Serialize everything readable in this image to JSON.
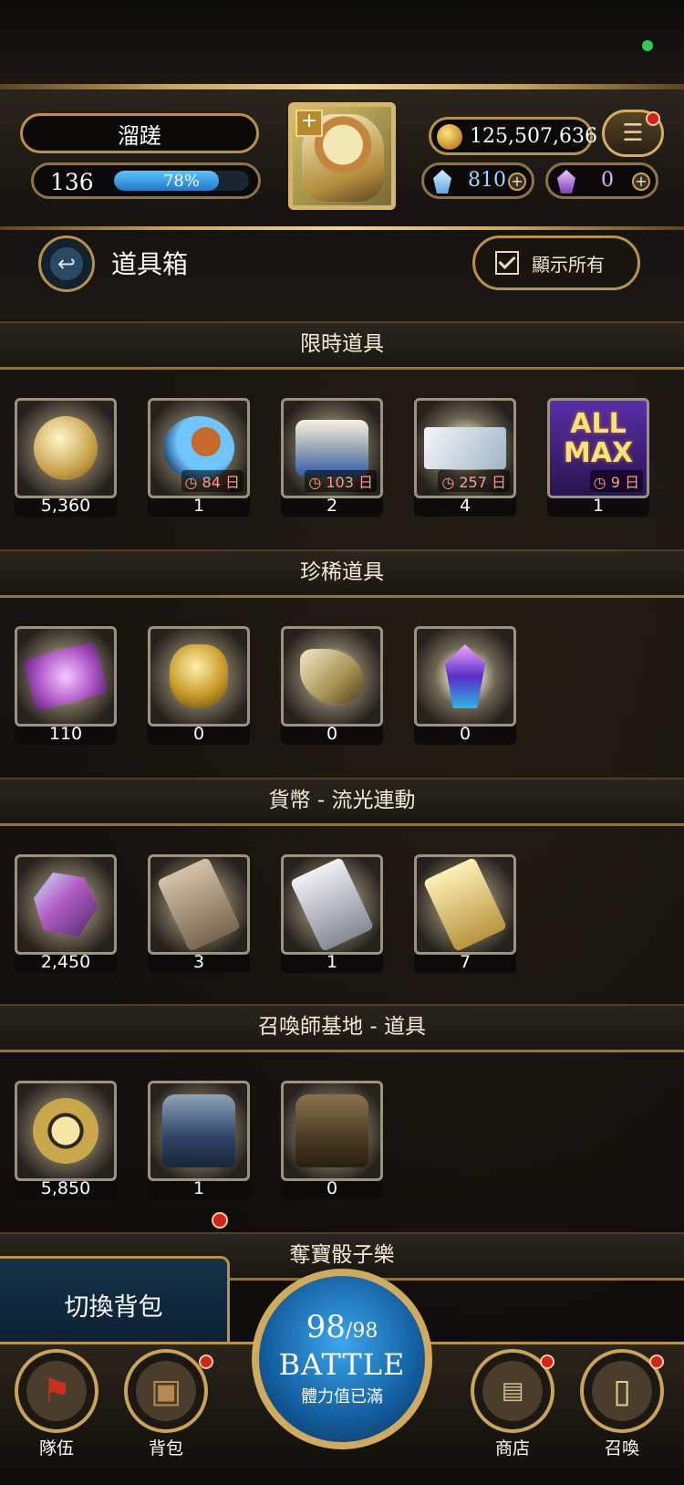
{
  "player": {
    "name": "溜蹉",
    "level": "136",
    "exp_percent_label": "78%",
    "exp_percent": 78
  },
  "currency": {
    "coins": "125,507,636",
    "gems": "810",
    "crystals": "0"
  },
  "page": {
    "title": "道具箱",
    "show_all_label": "顯示所有"
  },
  "sections": [
    {
      "title": "限時道具",
      "items": [
        {
          "icon": "coin-medal-icon",
          "count": "5,360",
          "timer": ""
        },
        {
          "icon": "lion-orb-icon",
          "count": "1",
          "timer": "84 日"
        },
        {
          "icon": "treasure-chest-icon",
          "count": "2",
          "timer": "103 日"
        },
        {
          "icon": "ticket-icon",
          "count": "4",
          "timer": "257 日"
        },
        {
          "icon": "all-max-icon",
          "count": "1",
          "timer": "9 日",
          "text": "ALL MAX"
        }
      ]
    },
    {
      "title": "珍稀道具",
      "items": [
        {
          "icon": "pink-card-icon",
          "count": "110"
        },
        {
          "icon": "golden-heart-icon",
          "count": "0"
        },
        {
          "icon": "horn-shell-icon",
          "count": "0"
        },
        {
          "icon": "purple-crystal-icon",
          "count": "0"
        }
      ]
    },
    {
      "title": "貨幣 - 流光連動",
      "items": [
        {
          "icon": "prism-gem-icon",
          "count": "2,450"
        },
        {
          "icon": "bronze-card-icon",
          "count": "3"
        },
        {
          "icon": "silver-card-icon",
          "count": "1"
        },
        {
          "icon": "gold-card-icon",
          "count": "7"
        }
      ]
    },
    {
      "title": "召喚師基地 - 道具",
      "items": [
        {
          "icon": "turtle-coin-icon",
          "count": "5,850"
        },
        {
          "icon": "blue-backpack-icon",
          "count": "1"
        },
        {
          "icon": "brown-backpack-icon",
          "count": "0"
        }
      ]
    },
    {
      "title": "奪寶骰子樂",
      "items": []
    }
  ],
  "switch_bag_label": "切換背包",
  "nav": {
    "team_label": "隊伍",
    "bag_label": "背包",
    "shop_label": "商店",
    "summon_label": "召喚",
    "battle_stamina": "98",
    "battle_stamina_max": "/98",
    "battle_label": "BATTLE",
    "battle_sub": "體力值已滿"
  },
  "colors": {
    "accent_gold": "#c9a35a",
    "exp_blue": "#1f79c9",
    "badge_red": "#d1251b",
    "timer_red": "#ff9b8d"
  }
}
